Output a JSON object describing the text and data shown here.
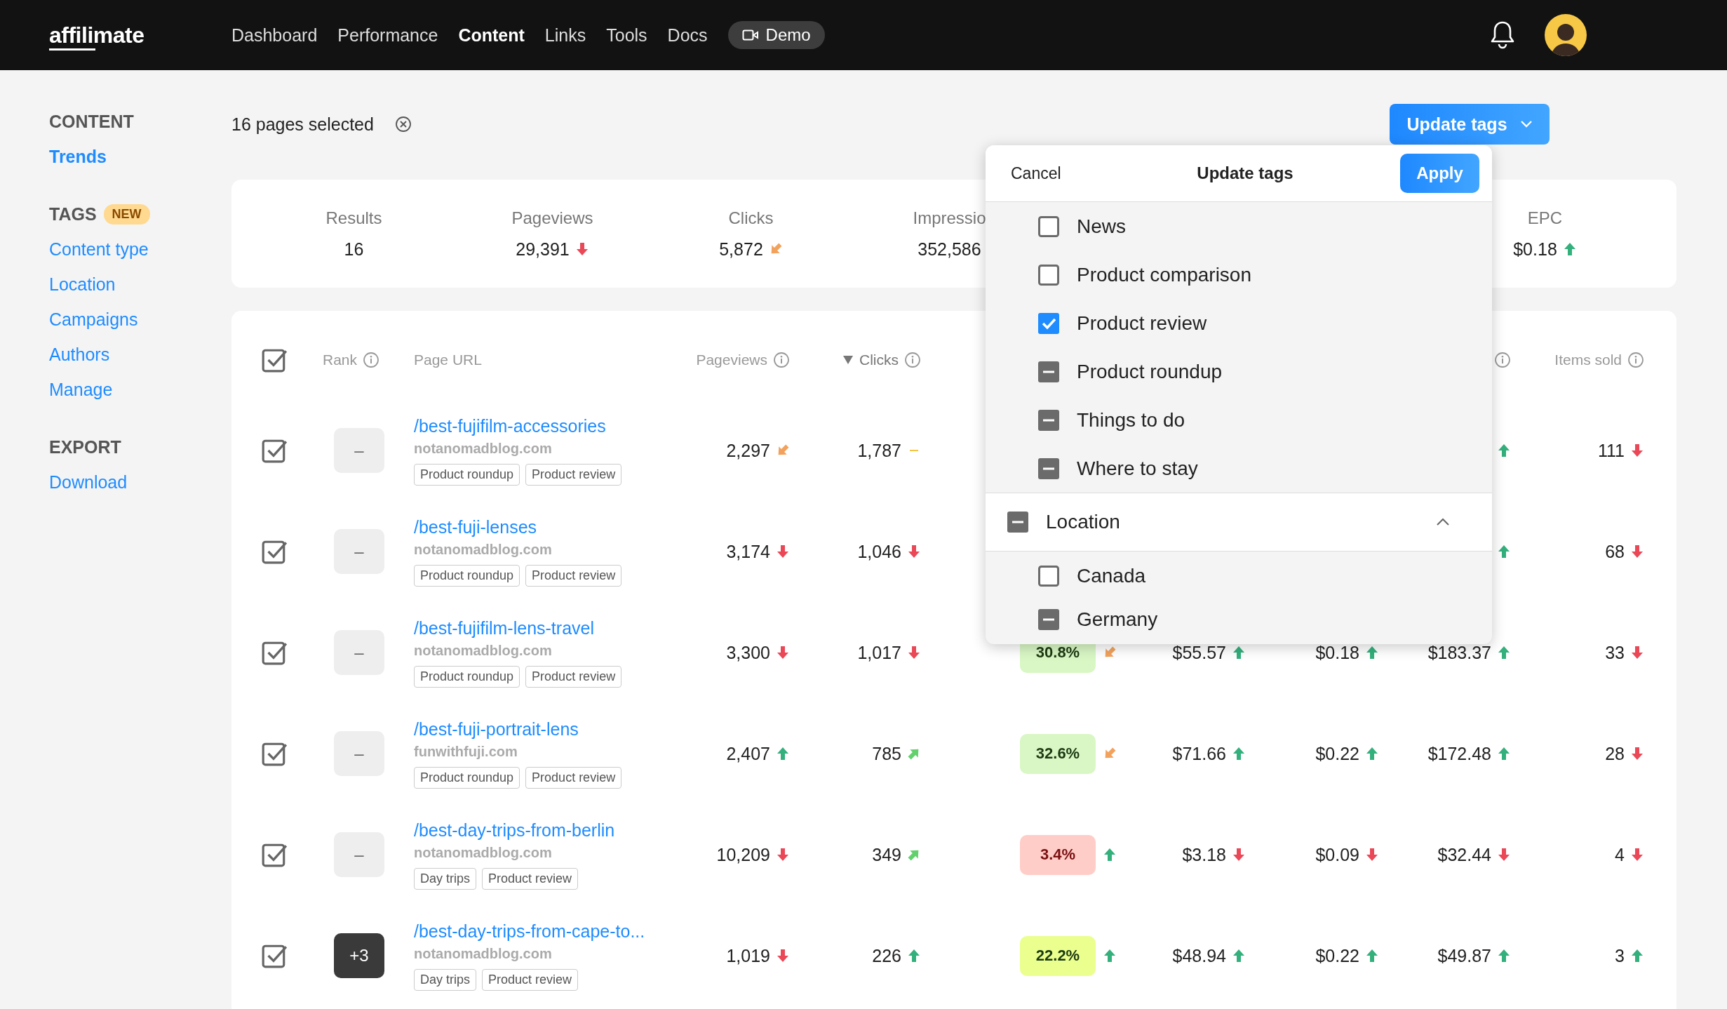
{
  "nav": {
    "logo": "affilimate",
    "items": [
      {
        "label": "Dashboard",
        "selected": false
      },
      {
        "label": "Performance",
        "selected": false
      },
      {
        "label": "Content",
        "selected": true
      },
      {
        "label": "Links",
        "selected": false
      },
      {
        "label": "Tools",
        "selected": false
      },
      {
        "label": "Docs",
        "selected": false
      }
    ],
    "demo": "Demo"
  },
  "sidebar": [
    {
      "heading": "CONTENT",
      "items": [
        {
          "label": "Trends",
          "selected": true
        }
      ]
    },
    {
      "heading": "TAGS",
      "badge": "NEW",
      "items": [
        {
          "label": "Content type",
          "selected": false
        },
        {
          "label": "Location",
          "selected": false
        },
        {
          "label": "Campaigns",
          "selected": false
        },
        {
          "label": "Authors",
          "selected": false
        },
        {
          "label": "Manage",
          "selected": false
        }
      ]
    },
    {
      "heading": "EXPORT",
      "items": [
        {
          "label": "Download",
          "selected": false
        }
      ]
    }
  ],
  "selection": "16 pages selected",
  "update_button": "Update tags",
  "stats": [
    {
      "label": "Results",
      "value": "16"
    },
    {
      "label": "Pageviews",
      "value": "29,391",
      "kind": "down"
    },
    {
      "label": "Clicks",
      "value": "5,872",
      "kind": "down-left"
    },
    {
      "label": "Impressio",
      "value": "352,586"
    },
    {
      "label": "EPC",
      "value": "$0.18",
      "kind": "up"
    }
  ],
  "table": {
    "header_checked": true,
    "columns": {
      "rank": {
        "label": "Rank",
        "info": true
      },
      "page_url": {
        "label": "Page URL"
      },
      "pageviews": {
        "label": "Pageviews",
        "info": true
      },
      "clicks": {
        "label": "Clicks",
        "info": true,
        "sorted": true
      },
      "column_9": {
        "info": true
      },
      "items_sold": {
        "label": "Items sold",
        "info": true
      }
    },
    "rows": [
      {
        "checked": true,
        "rank": "–",
        "rank_emphasized": false,
        "url": "/best-fujifilm-accessories",
        "domain": "notanomadblog.com",
        "tags": [
          "Product roundup",
          "Product review"
        ],
        "pageviews": {
          "value": "2,297",
          "kind": "down-left"
        },
        "clicks": {
          "value": "1,787",
          "kind": "flat"
        },
        "column_9": {
          "kind": "up"
        },
        "items_sold": {
          "value": "111",
          "kind": "down"
        }
      },
      {
        "checked": true,
        "rank": "–",
        "rank_emphasized": false,
        "url": "/best-fuji-lenses",
        "domain": "notanomadblog.com",
        "tags": [
          "Product roundup",
          "Product review"
        ],
        "pageviews": {
          "value": "3,174",
          "kind": "down"
        },
        "clicks": {
          "value": "1,046",
          "kind": "down"
        },
        "column_9": {
          "kind": "up"
        },
        "items_sold": {
          "value": "68",
          "kind": "down"
        }
      },
      {
        "checked": true,
        "rank": "–",
        "rank_emphasized": false,
        "url": "/best-fujifilm-lens-travel",
        "domain": "notanomadblog.com",
        "tags": [
          "Product roundup",
          "Product review"
        ],
        "pageviews": {
          "value": "3,300",
          "kind": "down"
        },
        "clicks": {
          "value": "1,017",
          "kind": "down"
        },
        "conversion": {
          "value": "30.8%",
          "color": "#d9f7c5",
          "negative": false,
          "kind": "down-left"
        },
        "revenue": {
          "value": "$55.57",
          "kind": "up"
        },
        "epc": {
          "value": "$0.18",
          "kind": "up"
        },
        "column_9": {
          "value": "$183.37",
          "kind": "up"
        },
        "items_sold": {
          "value": "33",
          "kind": "down"
        }
      },
      {
        "checked": true,
        "rank": "–",
        "rank_emphasized": false,
        "url": "/best-fuji-portrait-lens",
        "domain": "funwithfuji.com",
        "tags": [
          "Product roundup",
          "Product review"
        ],
        "pageviews": {
          "value": "2,407",
          "kind": "up"
        },
        "clicks": {
          "value": "785",
          "kind": "up-right"
        },
        "conversion": {
          "value": "32.6%",
          "color": "#d9f7c5",
          "negative": false,
          "kind": "down-left"
        },
        "revenue": {
          "value": "$71.66",
          "kind": "up"
        },
        "epc": {
          "value": "$0.22",
          "kind": "up"
        },
        "column_9": {
          "value": "$172.48",
          "kind": "up"
        },
        "items_sold": {
          "value": "28",
          "kind": "down"
        }
      },
      {
        "checked": true,
        "rank": "–",
        "rank_emphasized": false,
        "url": "/best-day-trips-from-berlin",
        "domain": "notanomadblog.com",
        "tags": [
          "Day trips",
          "Product review"
        ],
        "pageviews": {
          "value": "10,209",
          "kind": "down"
        },
        "clicks": {
          "value": "349",
          "kind": "up-right"
        },
        "conversion": {
          "value": "3.4%",
          "color": "#ffcdc7",
          "negative": true,
          "kind": "up"
        },
        "revenue": {
          "value": "$3.18",
          "kind": "down"
        },
        "epc": {
          "value": "$0.09",
          "kind": "down"
        },
        "column_9": {
          "value": "$32.44",
          "kind": "down"
        },
        "items_sold": {
          "value": "4",
          "kind": "down"
        }
      },
      {
        "checked": true,
        "rank": "+3",
        "rank_emphasized": true,
        "url": "/best-day-trips-from-cape-to...",
        "domain": "notanomadblog.com",
        "tags": [
          "Day trips",
          "Product review"
        ],
        "pageviews": {
          "value": "1,019",
          "kind": "down"
        },
        "clicks": {
          "value": "226",
          "kind": "up"
        },
        "conversion": {
          "value": "22.2%",
          "color": "#ebff8f",
          "negative": false,
          "kind": "up"
        },
        "revenue": {
          "value": "$48.94",
          "kind": "up"
        },
        "epc": {
          "value": "$0.22",
          "kind": "up"
        },
        "column_9": {
          "value": "$49.87",
          "kind": "up"
        },
        "items_sold": {
          "value": "3",
          "kind": "up"
        }
      }
    ]
  },
  "popup": {
    "cancel": "Cancel",
    "title": "Update tags",
    "apply": "Apply",
    "groups": [
      {
        "items": [
          {
            "label": "News",
            "checked": false,
            "mixed": false
          },
          {
            "label": "Product comparison",
            "checked": false,
            "mixed": false
          },
          {
            "label": "Product review",
            "checked": true,
            "mixed": false
          },
          {
            "label": "Product roundup",
            "checked": false,
            "mixed": true
          },
          {
            "label": "Things to do",
            "checked": false,
            "mixed": true
          },
          {
            "label": "Where to stay",
            "checked": false,
            "mixed": true
          }
        ]
      },
      {
        "label": "Location",
        "checked": false,
        "mixed": true,
        "expanded": true,
        "items": [
          {
            "label": "Canada",
            "checked": false,
            "mixed": false
          },
          {
            "label": "Germany",
            "checked": false,
            "mixed": true
          }
        ]
      }
    ]
  }
}
